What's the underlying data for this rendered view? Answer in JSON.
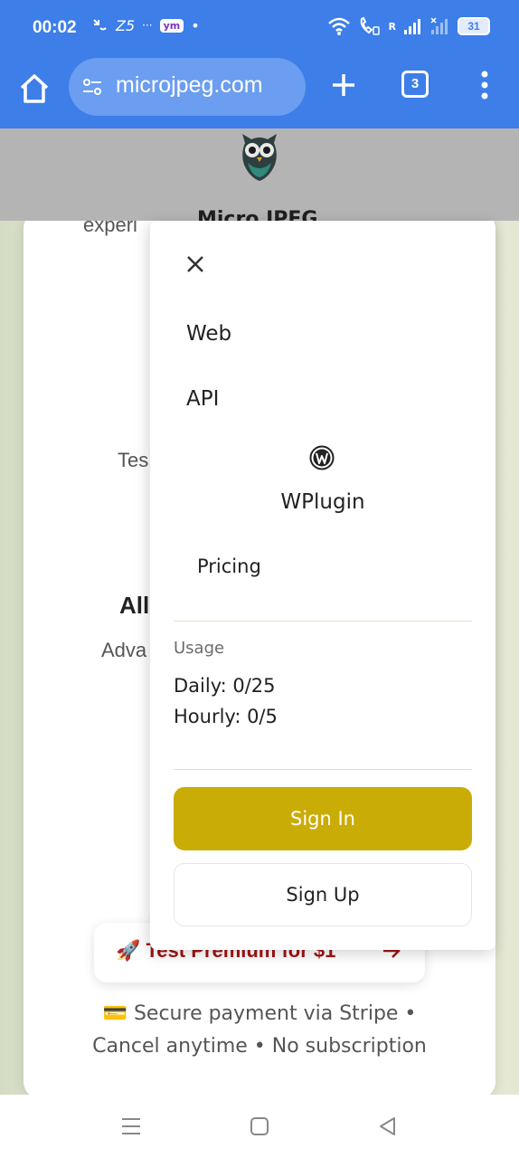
{
  "status_bar": {
    "time": "00:02",
    "carrier_mark": "Z5",
    "dots": "···",
    "app_badge": "ym",
    "dot": "•",
    "signal_r": "R",
    "battery": "31"
  },
  "browser": {
    "url": "microjpeg.com",
    "tab_count": "3"
  },
  "header": {
    "brand_peek": "Micro JPEG"
  },
  "background": {
    "text_experience": "experi",
    "text_test": "Tes",
    "heading_all": "All",
    "text_advanced": "Adva",
    "premium_button": "🚀 Test Premium for $1",
    "secure_line_1": "💳 Secure payment via Stripe •",
    "secure_line_2": "Cancel anytime • No subscription"
  },
  "drawer": {
    "items": [
      {
        "label": "Web"
      },
      {
        "label": "API"
      },
      {
        "label": "WPlugin"
      },
      {
        "label": "Pricing"
      }
    ],
    "usage_title": "Usage",
    "daily": "Daily: 0/25",
    "hourly": "Hourly: 0/5",
    "sign_in": "Sign In",
    "sign_up": "Sign Up"
  },
  "colors": {
    "browser_blue": "#3d7ee8",
    "sign_in_gold": "#c9ac06",
    "premium_red": "#a11414"
  },
  "icons": [
    "home-icon",
    "tune-icon",
    "plus-icon",
    "tabs-icon",
    "more-icon",
    "owl-logo",
    "close-icon",
    "wordpress-icon",
    "arrow-right-icon",
    "menu-icon",
    "square-icon",
    "back-icon"
  ]
}
